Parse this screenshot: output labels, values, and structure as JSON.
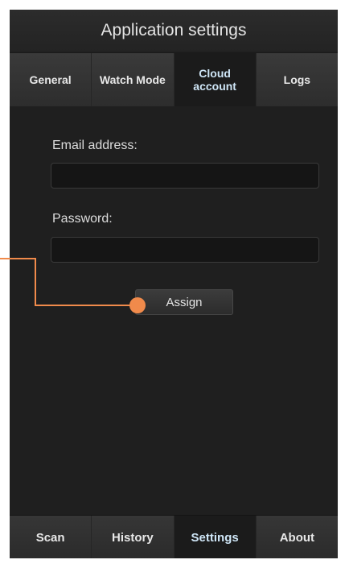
{
  "header": {
    "title": "Application settings"
  },
  "tabs": [
    {
      "label": "General",
      "active": false
    },
    {
      "label": "Watch Mode",
      "active": false
    },
    {
      "label": "Cloud\naccount",
      "active": true
    },
    {
      "label": "Logs",
      "active": false
    }
  ],
  "form": {
    "email_label": "Email address:",
    "email_value": "",
    "password_label": "Password:",
    "password_value": "",
    "assign_label": "Assign"
  },
  "bottom_nav": [
    {
      "label": "Scan",
      "active": false
    },
    {
      "label": "History",
      "active": false
    },
    {
      "label": "Settings",
      "active": true
    },
    {
      "label": "About",
      "active": false
    }
  ],
  "colors": {
    "background": "#1f1f1f",
    "active_text": "#cfe6f7",
    "callout": "#f08a4b"
  }
}
